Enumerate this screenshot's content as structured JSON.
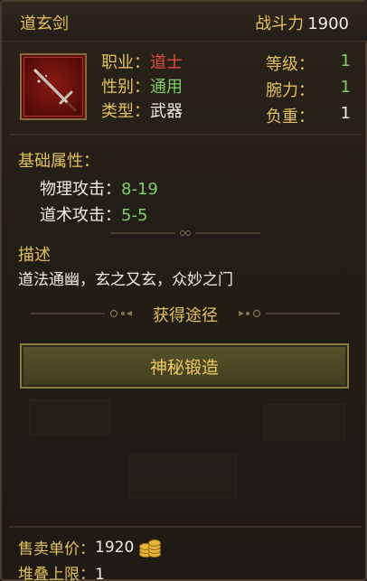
{
  "header": {
    "item_name": "道玄剑",
    "power_label": "战斗力",
    "power_value": "1900"
  },
  "item": {
    "icon": "sword-icon"
  },
  "attributes": {
    "profession": {
      "label": "职业",
      "value": "道士"
    },
    "gender": {
      "label": "性别",
      "value": "通用"
    },
    "type": {
      "label": "类型",
      "value": "武器"
    },
    "level": {
      "label": "等级",
      "value": "1"
    },
    "strength": {
      "label": "腕力",
      "value": "1"
    },
    "weight": {
      "label": "负重",
      "value": "1"
    },
    "separator": "："
  },
  "base": {
    "title": "基础属性：",
    "stats": [
      {
        "label": "物理攻击：",
        "value": "8-19"
      },
      {
        "label": "道术攻击：",
        "value": "5-5"
      }
    ]
  },
  "description": {
    "title": "描述",
    "text": "道法通幽，玄之又玄，众妙之门"
  },
  "obtain": {
    "title": "获得途径",
    "button_label": "神秘锻造"
  },
  "footer": {
    "sell_label": "售卖单价：",
    "sell_value": "1920",
    "currency_icon": "gold-coins-icon",
    "stack_label": "堆叠上限：",
    "stack_value": "1"
  },
  "colors": {
    "gold": "#e3c15a",
    "red": "#e04b3a",
    "green": "#7fd063",
    "button": "#4a4725"
  }
}
